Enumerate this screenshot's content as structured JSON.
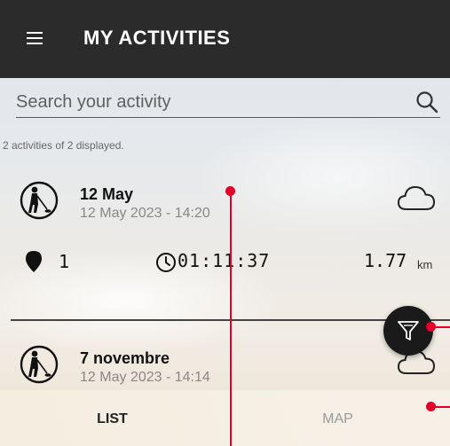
{
  "header": {
    "title": "MY ACTIVITIES"
  },
  "search": {
    "placeholder": "Search your activity",
    "value": ""
  },
  "summary": {
    "count_text": "2 activities of 2 displayed."
  },
  "activities": [
    {
      "name": "12 May",
      "date": "12 May 2023 - 14:20",
      "points": "1",
      "duration": "01:11:37",
      "distance": "1.77",
      "distance_unit": "km",
      "weather": "cloud-icon"
    },
    {
      "name": "7 novembre",
      "date": "12 May 2023 - 14:14",
      "weather": "cloud-icon"
    }
  ],
  "tabs": [
    {
      "label": "LIST",
      "active": true
    },
    {
      "label": "MAP",
      "active": false
    }
  ],
  "icons": {
    "menu": "hamburger-menu-icon",
    "search": "search-icon",
    "activity": "metal-detector-person-icon",
    "points": "map-pin-icon",
    "duration": "clock-icon",
    "filter": "filter-icon"
  },
  "colors": {
    "topbar": "#2b2b2b",
    "fab": "#1a1a1a",
    "annotation": "#e0002a",
    "inactive_tab": "#9a9a9a"
  }
}
